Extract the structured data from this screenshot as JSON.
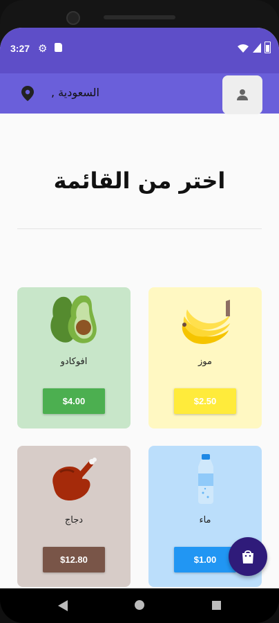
{
  "status_bar": {
    "time": "3:27",
    "icons": [
      "settings-gear-icon",
      "sd-card-icon",
      "wifi-icon",
      "signal-icon",
      "battery-icon"
    ]
  },
  "app_bar": {
    "location": "السعودية ,",
    "location_icon": "location-pin-icon",
    "profile_icon": "person-icon"
  },
  "main": {
    "title": "اختر من القائمة",
    "products": [
      {
        "name": "موز",
        "price": "$2.50",
        "icon": "banana-icon",
        "card_bg": "#fff8c2",
        "button_color": "#ffeb3b"
      },
      {
        "name": "افوكادو",
        "price": "$4.00",
        "icon": "avocado-icon",
        "card_bg": "#c8e6c9",
        "button_color": "#4caf50"
      },
      {
        "name": "ماء",
        "price": "$1.00",
        "icon": "water-bottle-icon",
        "card_bg": "#bbdefb",
        "button_color": "#2196f3"
      },
      {
        "name": "دجاج",
        "price": "$12.80",
        "icon": "roast-chicken-icon",
        "card_bg": "#d7ccc8",
        "button_color": "#795548"
      }
    ]
  },
  "fab": {
    "icon": "shopping-bag-icon"
  },
  "nav_bar": {
    "icons": [
      "back-icon",
      "home-icon",
      "recents-icon"
    ]
  }
}
